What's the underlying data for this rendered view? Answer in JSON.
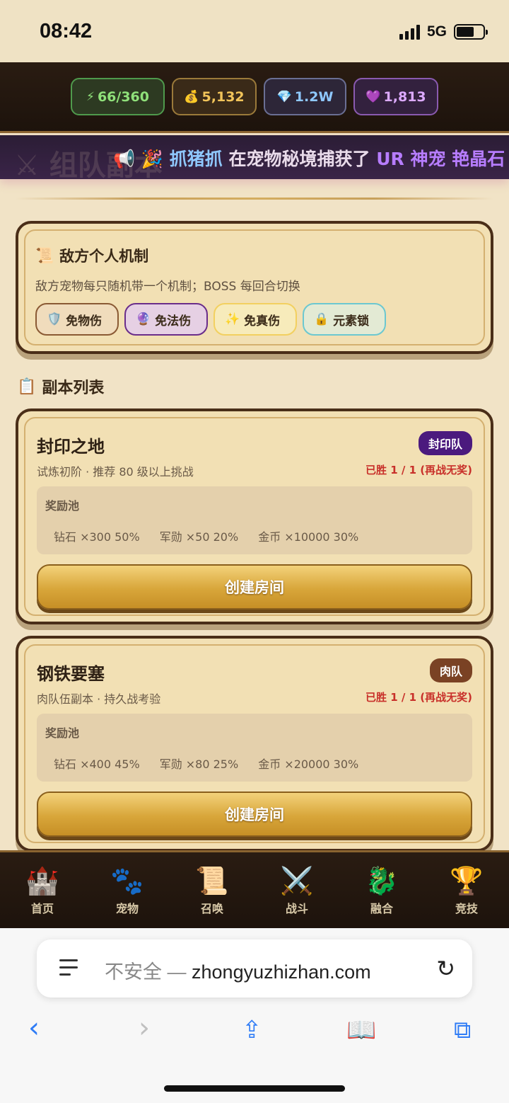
{
  "status": {
    "time": "08:42",
    "network": "5G"
  },
  "resources": {
    "energy": {
      "icon": "lightning-icon",
      "value": "66/360"
    },
    "gold": {
      "icon": "money-bag-icon",
      "value": "5,132"
    },
    "diamond": {
      "icon": "diamond-icon",
      "value": "1.2W"
    },
    "heart": {
      "icon": "heart-icon",
      "value": "1,813"
    }
  },
  "ticker": {
    "page_title_shadow": "组队副本",
    "player": "抓猪抓",
    "text": "在宠物秘境捕获了",
    "rarity": "UR 神宠",
    "tail": "艳晶石"
  },
  "mechanics": {
    "title": "敌方个人机制",
    "description": "敌方宠物每只随机带一个机制；BOSS 每回合切换",
    "tags": [
      {
        "label": "免物伤",
        "icon": "shield-icon"
      },
      {
        "label": "免法伤",
        "icon": "crystal-ball-icon"
      },
      {
        "label": "免真伤",
        "icon": "sparkle-icon"
      },
      {
        "label": "元素锁",
        "icon": "lock-icon"
      }
    ]
  },
  "list_title": "副本列表",
  "dungeons": [
    {
      "name": "封印之地",
      "badge": "封印队",
      "subtitle": "试炼初阶 · 推荐 80 级以上挑战",
      "wins": "已胜 1 / 1 (再战无奖)",
      "pool_label": "奖励池",
      "rewards": [
        "钻石 ×300 50%",
        "军勋 ×50 20%",
        "金币 ×10000 30%"
      ],
      "button": "创建房间"
    },
    {
      "name": "钢铁要塞",
      "badge": "肉队",
      "subtitle": "肉队伍副本 · 持久战考验",
      "wins": "已胜 1 / 1 (再战无奖)",
      "pool_label": "奖励池",
      "rewards": [
        "钻石 ×400 45%",
        "军勋 ×80 25%",
        "金币 ×20000 30%"
      ],
      "button": "创建房间"
    }
  ],
  "nav": [
    {
      "label": "首页",
      "icon": "castle-icon"
    },
    {
      "label": "宠物",
      "icon": "paw-icon"
    },
    {
      "label": "召唤",
      "icon": "scroll-icon"
    },
    {
      "label": "战斗",
      "icon": "crossed-swords-icon"
    },
    {
      "label": "融合",
      "icon": "dragon-icon"
    },
    {
      "label": "竞技",
      "icon": "trophy-icon"
    }
  ],
  "browser": {
    "insecure": "不安全 — ",
    "domain": "zhongyuzhizhan.com"
  }
}
